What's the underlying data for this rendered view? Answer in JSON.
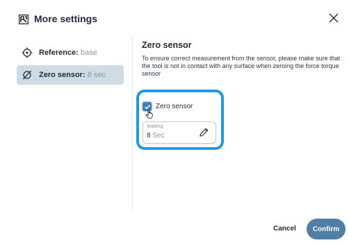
{
  "dialog": {
    "title": "More settings",
    "close_icon": "close-icon",
    "logo_icon": "brand-logo-icon"
  },
  "sidebar": {
    "items": [
      {
        "label": "Reference:",
        "value": "base",
        "icon": "reference-crosshair-icon",
        "selected": false
      },
      {
        "label": "Zero sensor:",
        "value": "8 sec",
        "icon": "empty-set-icon",
        "selected": true
      }
    ]
  },
  "main": {
    "section_title": "Zero sensor",
    "description": "To ensure correct measurement from the sensor, please make sure that the tool is not in contact with any surface when zeroing the force torque sensor",
    "checkbox": {
      "label": "Zero sensor",
      "checked": true
    },
    "waiting_field": {
      "label": "Waiting",
      "value": "8",
      "unit": "Sec",
      "edit_icon": "pencil-icon"
    }
  },
  "footer": {
    "cancel_label": "Cancel",
    "confirm_label": "Confirm"
  },
  "colors": {
    "accent": "#4f7fa6",
    "focus_ring": "#1e9be0",
    "selected_bg": "#cfdce8",
    "checkbox": "#3f7fc1"
  }
}
